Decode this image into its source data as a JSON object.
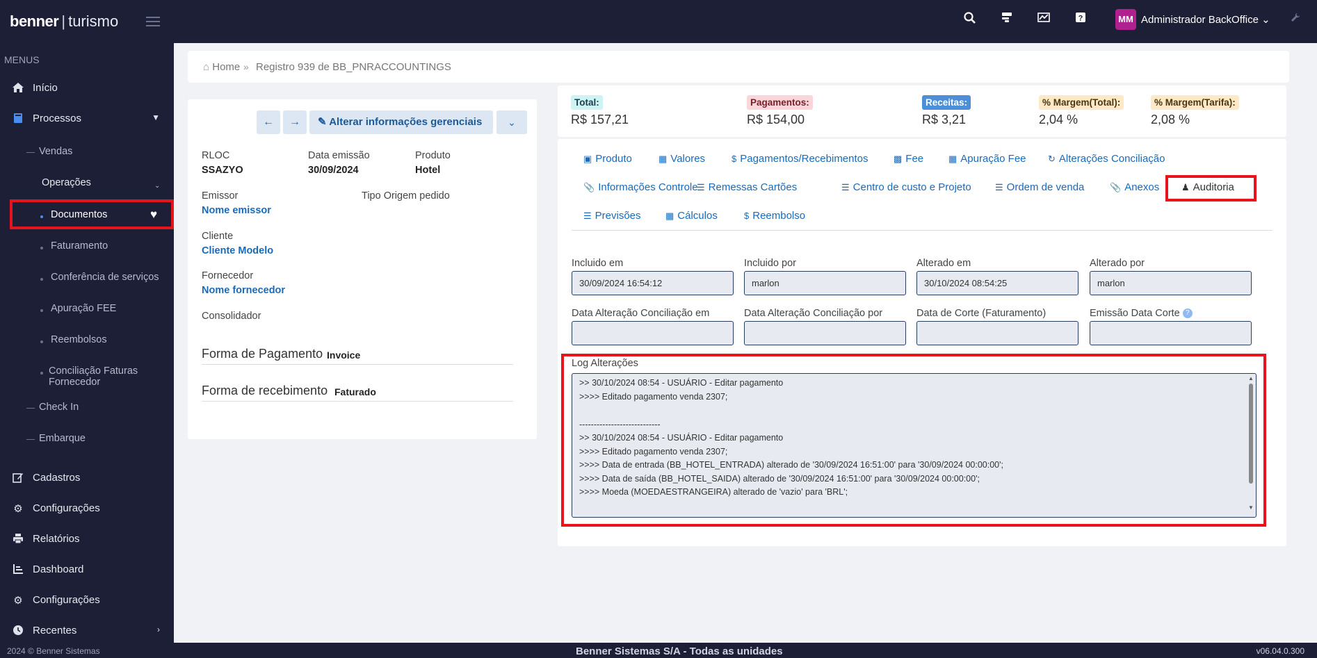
{
  "header": {
    "logo_brand": "benner",
    "logo_sep": "|",
    "logo_product": "turismo",
    "avatar": "MM",
    "user_name": "Administrador BackOffice",
    "icons": [
      "search-icon",
      "server-icon",
      "chart-icon",
      "help-icon",
      "wrench-icon"
    ]
  },
  "sidebar": {
    "title": "MENUS",
    "inicio": "Início",
    "processos": "Processos",
    "vendas": "Vendas",
    "operacoes": "Operações",
    "documentos": "Documentos",
    "faturamento": "Faturamento",
    "conferencia": "Conferência de serviços",
    "apuracao": "Apuração FEE",
    "reembolsos": "Reembolsos",
    "conciliacao_1": "Conciliação Faturas",
    "conciliacao_2": "Fornecedor",
    "checkin": "Check In",
    "embarque": "Embarque",
    "cadastros": "Cadastros",
    "configuracoes1": "Configurações",
    "relatorios": "Relatórios",
    "dashboard": "Dashboard",
    "configuracoes2": "Configurações",
    "recentes": "Recentes",
    "copyright": "2024 © Benner Sistemas"
  },
  "breadcrumb": {
    "home": "Home",
    "record": "Registro 939 de BB_PNRACCOUNTINGS"
  },
  "left": {
    "alter_button": "Alterar informações gerenciais",
    "rloc_label": "RLOC",
    "rloc_value": "SSAZYO",
    "emissao_label": "Data emissão",
    "emissao_value": "30/09/2024",
    "produto_label": "Produto",
    "produto_value": "Hotel",
    "emissor_label": "Emissor",
    "emissor_value": "Nome emissor",
    "tipo_origem_label": "Tipo Origem pedido",
    "cliente_label": "Cliente",
    "cliente_value": "Cliente Modelo",
    "fornecedor_label": "Fornecedor",
    "fornecedor_value": "Nome fornecedor",
    "consolidador_label": "Consolidador",
    "forma_pagamento_label": "Forma de Pagamento",
    "forma_pagamento_value": "Invoice",
    "forma_recebimento_label": "Forma de recebimento",
    "forma_recebimento_value": "Faturado"
  },
  "totals": {
    "total_label": "Total:",
    "total_value": "R$ 157,21",
    "pagamentos_label": "Pagamentos:",
    "pagamentos_value": "R$ 154,00",
    "receitas_label": "Receitas:",
    "receitas_value": "R$ 3,21",
    "margem_total_label": "% Margem(Total):",
    "margem_total_value": "2,04 %",
    "margem_tarifa_label": "% Margem(Tarifa):",
    "margem_tarifa_value": "2,08 %",
    "colors": {
      "total_bg": "#cdf3f2",
      "pagamentos_bg": "#f9d6d9",
      "receitas_bg": "#4a8fd8",
      "margem_bg": "#fde9c6"
    }
  },
  "tabs": {
    "produto": "Produto",
    "valores": "Valores",
    "pagamentos": "Pagamentos/Recebimentos",
    "fee": "Fee",
    "apuracao_fee": "Apuração Fee",
    "alteracoes": "Alterações Conciliação",
    "info_controle": "Informações Controle",
    "remessas": "Remessas Cartões",
    "centro_custo": "Centro de custo e Projeto",
    "ordem_venda": "Ordem de venda",
    "anexos": "Anexos",
    "auditoria": "Auditoria",
    "previsoes": "Previsões",
    "calculos": "Cálculos",
    "reembolso": "Reembolso"
  },
  "audit": {
    "incluido_em_label": "Incluido em",
    "incluido_em_value": "30/09/2024 16:54:12",
    "incluido_por_label": "Incluido por",
    "incluido_por_value": "marlon",
    "alterado_em_label": "Alterado em",
    "alterado_em_value": "30/10/2024 08:54:25",
    "alterado_por_label": "Alterado por",
    "alterado_por_value": "marlon",
    "data_alt_conc_em_label": "Data Alteração Conciliação em",
    "data_alt_conc_por_label": "Data Alteração Conciliação por",
    "data_corte_label": "Data de Corte (Faturamento)",
    "emissao_data_corte_label": "Emissão Data Corte",
    "help_glyph": "?",
    "log_label": "Log Alterações",
    "log_lines": [
      ">> 30/10/2024 08:54 - USUÁRIO - Editar pagamento",
      ">>>> Editado pagamento venda 2307;",
      "",
      "----------------------------",
      ">> 30/10/2024 08:54 - USUÁRIO - Editar pagamento",
      ">>>> Editado pagamento venda 2307;",
      ">>>> Data de entrada (BB_HOTEL_ENTRADA) alterado de '30/09/2024 16:51:00' para '30/09/2024 00:00:00';",
      ">>>> Data de saída (BB_HOTEL_SAIDA) alterado de '30/09/2024 16:51:00' para '30/09/2024 00:00:00';",
      ">>>> Moeda (MOEDAESTRANGEIRA) alterado de 'vazio' para 'BRL';"
    ]
  },
  "footer": {
    "center": "Benner Sistemas S/A - Todas as unidades",
    "version": "v06.04.0.300"
  }
}
